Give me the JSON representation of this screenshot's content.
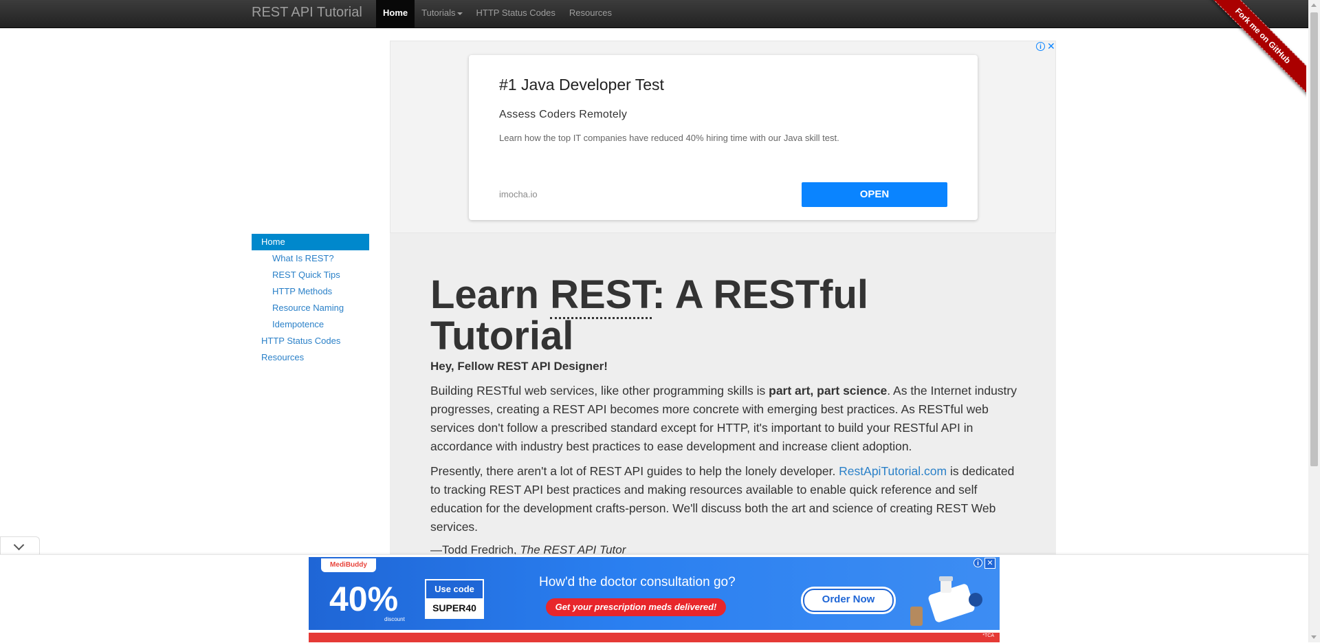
{
  "navbar": {
    "brand": "REST API Tutorial",
    "items": [
      {
        "label": "Home",
        "active": true
      },
      {
        "label": "Tutorials",
        "dropdown": true
      },
      {
        "label": "HTTP Status Codes"
      },
      {
        "label": "Resources"
      }
    ],
    "ribbon": "Fork me on GitHub"
  },
  "ad_top": {
    "title": "#1 Java Developer Test",
    "subtitle": "Assess Coders Remotely",
    "description": "Learn how the top IT companies have reduced 40% hiring time with our Java skill test.",
    "domain": "imocha.io",
    "button": "OPEN",
    "accent_color": "#0a84ff"
  },
  "sidebar": {
    "items": [
      {
        "label": "Home",
        "active": true
      },
      {
        "label": "What Is REST?",
        "sub": true
      },
      {
        "label": "REST Quick Tips",
        "sub": true
      },
      {
        "label": "HTTP Methods",
        "sub": true
      },
      {
        "label": "Resource Naming",
        "sub": true
      },
      {
        "label": "Idempotence",
        "sub": true
      },
      {
        "label": "HTTP Status Codes"
      },
      {
        "label": "Resources"
      }
    ],
    "active_color": "#0088cc",
    "link_color": "#2a80c8"
  },
  "hero": {
    "title_pre": "Learn ",
    "title_abbr": "REST",
    "title_post": ": A RESTful Tutorial",
    "greeting": "Hey, Fellow REST API Designer!",
    "p1_pre": "Building RESTful web services, like other programming skills is ",
    "p1_bold": "part art, part science",
    "p1_post": ". As the Internet industry progresses, creating a REST API becomes more concrete with emerging best practices. As RESTful web services don't follow a prescribed standard except for HTTP, it's important to build your RESTful API in accordance with industry best practices to ease development and increase client adoption.",
    "p2_pre": "Presently, there aren't a lot of REST API guides to help the lonely developer. ",
    "p2_link": "RestApiTutorial.com",
    "p2_post": " is dedicated to tracking REST API best practices and making resources available to enable quick reference and self education for the development crafts-person. We'll discuss both the art and science of creating REST Web services.",
    "sig_pre": "—Todd Fredrich, ",
    "sig_italic": "The REST API Tutor"
  },
  "ad_bottom": {
    "logo": "MediBuddy",
    "percent": "40%",
    "percent_sub": "discount",
    "code_label": "Use code",
    "code": "SUPER40",
    "headline": "How'd the doctor consultation go?",
    "pill": "Get your prescription meds delivered!",
    "cta": "Order Now",
    "tc": "*TCA"
  },
  "icons": [
    "adchoices-icon",
    "close-icon",
    "chevron-down-icon",
    "caret-down-icon"
  ]
}
